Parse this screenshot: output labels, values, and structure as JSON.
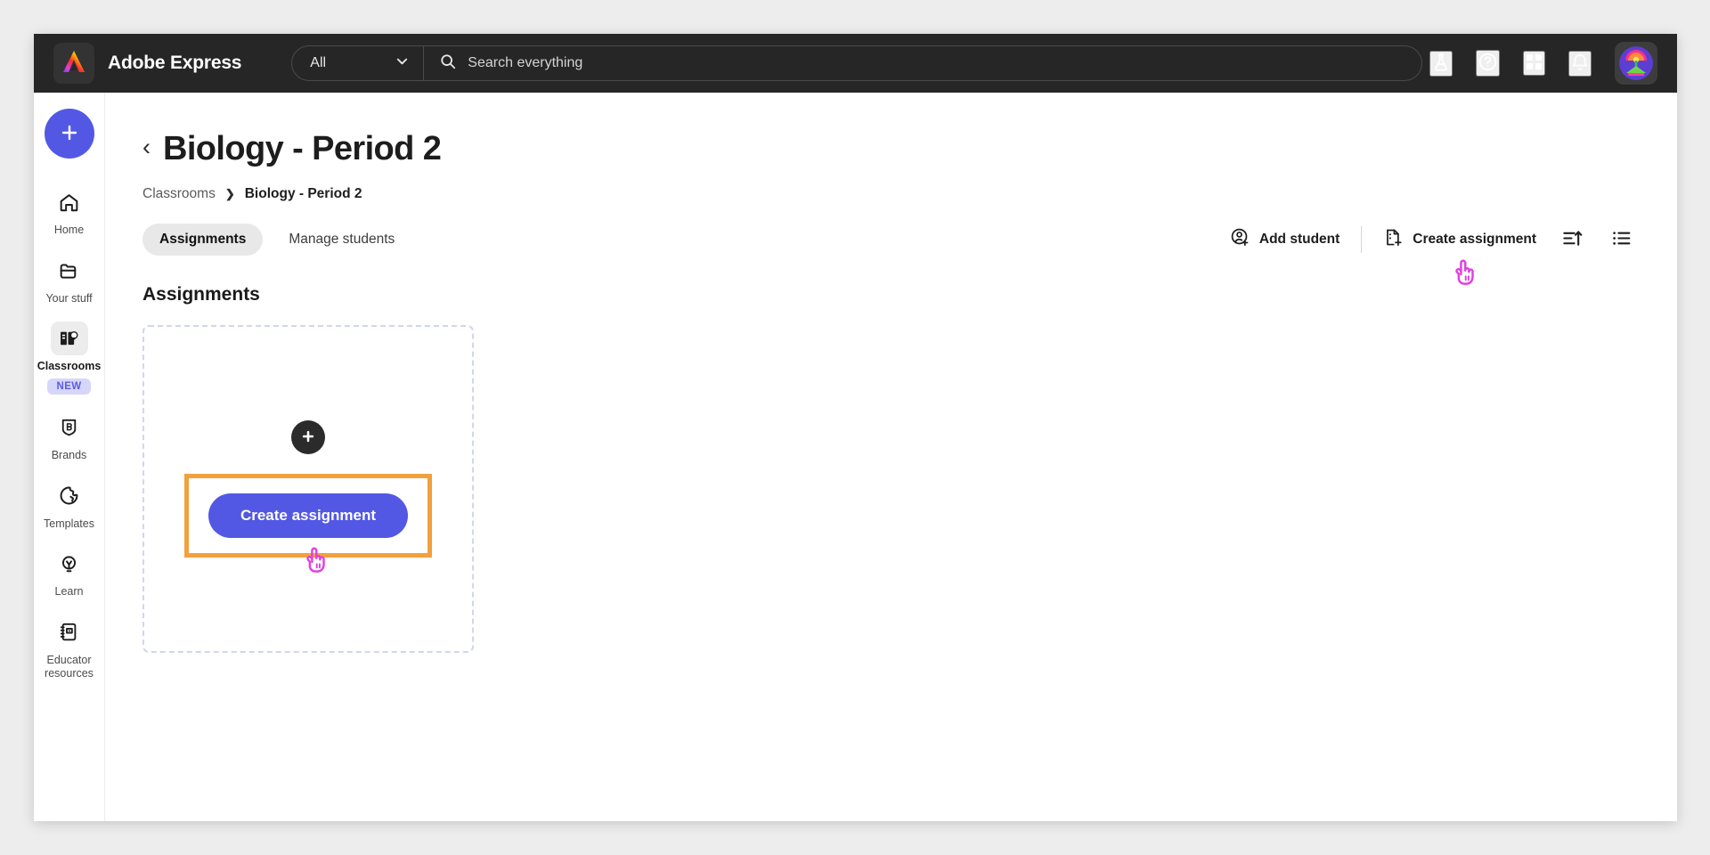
{
  "topbar": {
    "brand": "Adobe Express",
    "logo_icon": "adobe-express-logo",
    "scope_selected": "All",
    "scope_chevron_icon": "chevron-down-icon",
    "search_icon": "search-icon",
    "search_value": "",
    "search_placeholder": "Search everything",
    "actions": [
      {
        "icon": "beaker-icon",
        "name": "labs-button"
      },
      {
        "icon": "help-circle-icon",
        "name": "help-button"
      },
      {
        "icon": "apps-grid-icon",
        "name": "apps-button"
      },
      {
        "icon": "bell-icon",
        "name": "notifications-button"
      }
    ],
    "avatar_icon": "user-avatar"
  },
  "sidebar": {
    "create_button_icon": "plus-icon",
    "items": [
      {
        "label": "Home",
        "icon": "home-icon",
        "active": false,
        "badge": ""
      },
      {
        "label": "Your stuff",
        "icon": "folder-icon",
        "active": false,
        "badge": ""
      },
      {
        "label": "Classrooms",
        "icon": "classroom-icon",
        "active": true,
        "badge": "NEW"
      },
      {
        "label": "Brands",
        "icon": "brand-shield-icon",
        "active": false,
        "badge": ""
      },
      {
        "label": "Templates",
        "icon": "templates-icon",
        "active": false,
        "badge": ""
      },
      {
        "label": "Learn",
        "icon": "lightbulb-icon",
        "active": false,
        "badge": ""
      },
      {
        "label": "Educator resources",
        "icon": "notebook-icon",
        "active": false,
        "badge": ""
      }
    ]
  },
  "main": {
    "back_chevron": "‹",
    "page_title": "Biology - Period 2",
    "breadcrumb": {
      "root": "Classrooms",
      "separator": "❯",
      "current": "Biology - Period 2"
    },
    "tabs": [
      {
        "label": "Assignments",
        "active": true
      },
      {
        "label": "Manage students",
        "active": false
      }
    ],
    "toolbar": {
      "add_student_label": "Add student",
      "add_student_icon": "user-plus-icon",
      "create_assignment_label": "Create assignment",
      "create_assignment_icon": "document-plus-icon",
      "sort_icon": "sort-ascending-icon",
      "list_view_icon": "list-view-icon"
    },
    "section_title": "Assignments",
    "empty_card": {
      "plus_icon": "plus-icon",
      "create_button_label": "Create assignment"
    },
    "cursor_icon": "pointing-hand-cursor"
  },
  "colors": {
    "accent_purple": "#5258E4",
    "highlight_orange": "#F2A03D",
    "cursor_magenta": "#E040E0",
    "topbar_dark": "#262626",
    "badge_bg": "#D6D6FB",
    "badge_text": "#5C5CE0",
    "dashed_border": "#D2D5F2"
  }
}
